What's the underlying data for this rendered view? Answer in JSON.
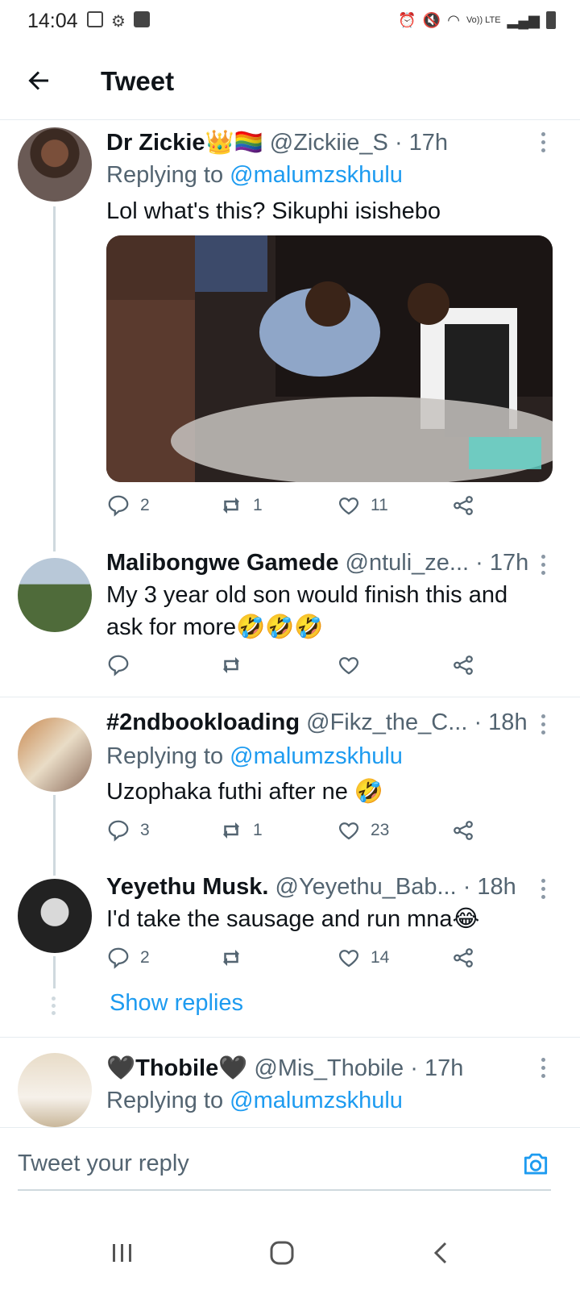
{
  "status_bar": {
    "time": "14:04",
    "network": "Vo)) LTE"
  },
  "header": {
    "title": "Tweet"
  },
  "tweets": [
    {
      "name": "Dr Zickie👑🏳️‍🌈",
      "handle": "@Zickiie_S",
      "time": "· 17h",
      "replying_prefix": "Replying to ",
      "replying_handle": "@malumzskhulu",
      "text": "Lol what's this? Sikuphi isishebo",
      "replies": "2",
      "retweets": "1",
      "likes": "11"
    },
    {
      "name": "Malibongwe Gamede",
      "handle": "@ntuli_ze...",
      "time": "· 17h",
      "text": "My 3 year old son would finish this and ask for more🤣🤣🤣",
      "replies": "",
      "retweets": "",
      "likes": ""
    },
    {
      "name": "#2ndbookloading",
      "handle": "@Fikz_the_C...",
      "time": "· 18h",
      "replying_prefix": "Replying to ",
      "replying_handle": "@malumzskhulu",
      "text": "Uzophaka futhi after ne 🤣",
      "replies": "3",
      "retweets": "1",
      "likes": "23"
    },
    {
      "name": "Yeyethu Musk.",
      "handle": "@Yeyethu_Bab...",
      "time": "· 18h",
      "text": "I'd take the sausage and run mna😂",
      "replies": "2",
      "retweets": "",
      "likes": "14",
      "show_replies": "Show replies"
    },
    {
      "name": "🖤Thobile🖤",
      "handle": "@Mis_Thobile",
      "time": "· 17h",
      "replying_prefix": "Replying to ",
      "replying_handle": "@malumzskhulu"
    }
  ],
  "compose": {
    "placeholder": "Tweet your reply"
  },
  "icons": [
    "back-arrow-icon",
    "reply-icon",
    "retweet-icon",
    "like-icon",
    "share-icon",
    "more-icon",
    "camera-icon",
    "recent-apps-icon",
    "home-icon",
    "back-icon"
  ],
  "colors": {
    "accent": "#1d9bf0",
    "text": "#0f1419",
    "secondary": "#536471"
  }
}
